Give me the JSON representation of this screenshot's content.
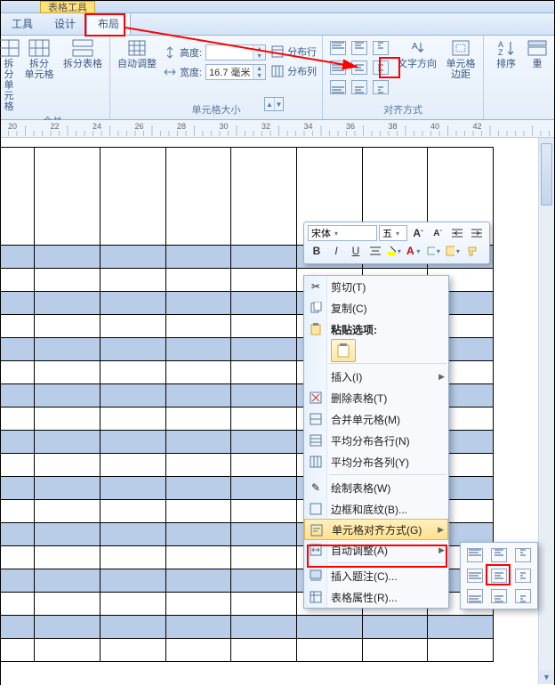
{
  "context_tab": "表格工具",
  "tabs": {
    "tools": "工具",
    "design": "设计",
    "layout": "布局"
  },
  "ribbon": {
    "merge_group": "合并",
    "merge_split_cells": "拆分\n单元格",
    "split_table": "拆分表格",
    "autofit": "自动调整",
    "cellsize_group": "单元格大小",
    "height_label": "高度:",
    "height_value": "",
    "width_label": "宽度:",
    "width_value": "16.7 毫米",
    "dist_rows": "分布行",
    "dist_cols": "分布列",
    "align_group": "对齐方式",
    "text_dir": "文字方向",
    "cell_margin": "单元格\n边距",
    "sort": "排序",
    "repeat": "重"
  },
  "minitoolbar": {
    "font": "宋体",
    "size": "五",
    "bold": "B",
    "italic": "I",
    "grow": "A",
    "shrink": "A"
  },
  "ctx": {
    "cut": "剪切(T)",
    "copy": "复制(C)",
    "paste_hdr": "粘贴选项:",
    "insert": "插入(I)",
    "delete_table": "删除表格(T)",
    "merge_cells": "合并单元格(M)",
    "dist_rows": "平均分布各行(N)",
    "dist_cols": "平均分布各列(Y)",
    "draw_table": "绘制表格(W)",
    "borders": "边框和底纹(B)...",
    "cell_align": "单元格对齐方式(G)",
    "autofit": "自动调整(A)",
    "caption": "插入题注(C)...",
    "props": "表格属性(R)..."
  },
  "ruler_marks": [
    "20",
    "22",
    "24",
    "26",
    "28",
    "30",
    "32",
    "34",
    "36",
    "38",
    "40",
    "42"
  ]
}
